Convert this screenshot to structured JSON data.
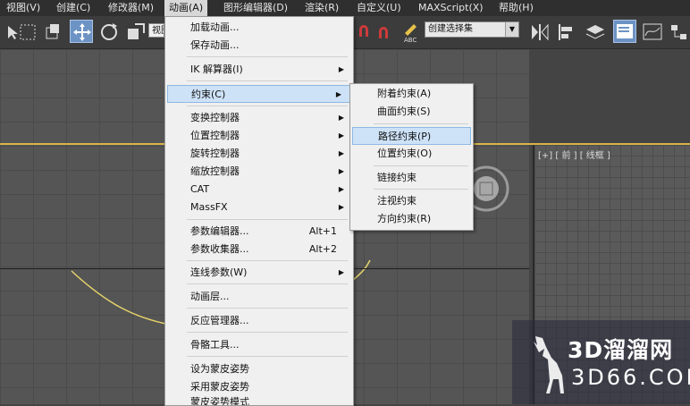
{
  "menubar": {
    "items": [
      "视图(V)",
      "创建(C)",
      "修改器(M)",
      "动画(A)",
      "图形编辑器(D)",
      "渲染(R)",
      "自定义(U)",
      "MAXScript(X)",
      "帮助(H)"
    ]
  },
  "toolbar": {
    "view_field": "视图",
    "selection_set": "创建选择集",
    "abc_label": "ABC"
  },
  "viewport_right": {
    "label": "[+] [ 前 ] [ 线框 ]"
  },
  "animation_menu": {
    "items": [
      {
        "label": "加载动画..."
      },
      {
        "label": "保存动画..."
      },
      {
        "label": "IK 解算器(I)",
        "sub": true
      },
      {
        "label": "约束(C)",
        "sub": true,
        "highlight": true
      },
      {
        "label": "变换控制器",
        "sub": true
      },
      {
        "label": "位置控制器",
        "sub": true
      },
      {
        "label": "旋转控制器",
        "sub": true
      },
      {
        "label": "缩放控制器",
        "sub": true
      },
      {
        "label": "CAT",
        "sub": true
      },
      {
        "label": "MassFX",
        "sub": true
      },
      {
        "label": "参数编辑器...",
        "shortcut": "Alt+1"
      },
      {
        "label": "参数收集器...",
        "shortcut": "Alt+2"
      },
      {
        "label": "连线参数(W)",
        "sub": true
      },
      {
        "label": "动画层..."
      },
      {
        "label": "反应管理器..."
      },
      {
        "label": "骨骼工具..."
      },
      {
        "label": "设为蒙皮姿势"
      },
      {
        "label": "采用蒙皮姿势"
      },
      {
        "label": "蒙皮姿势模式"
      }
    ]
  },
  "constraint_submenu": {
    "items": [
      {
        "label": "附着约束(A)"
      },
      {
        "label": "曲面约束(S)"
      },
      {
        "label": "路径约束(P)",
        "highlight": true
      },
      {
        "label": "位置约束(O)"
      },
      {
        "label": "链接约束"
      },
      {
        "label": "注视约束"
      },
      {
        "label": "方向约束(R)"
      }
    ]
  },
  "watermark": {
    "title": "3D溜溜网",
    "url": "3D66.COM"
  },
  "colors": {
    "menubar_bg": "#2f2f2f",
    "menu_bg": "#f0f0f0",
    "highlight": "#cde2f7",
    "selected_tool": "#6d93c4",
    "viewport_bg": "#555555",
    "curve": "#e6d46a"
  }
}
